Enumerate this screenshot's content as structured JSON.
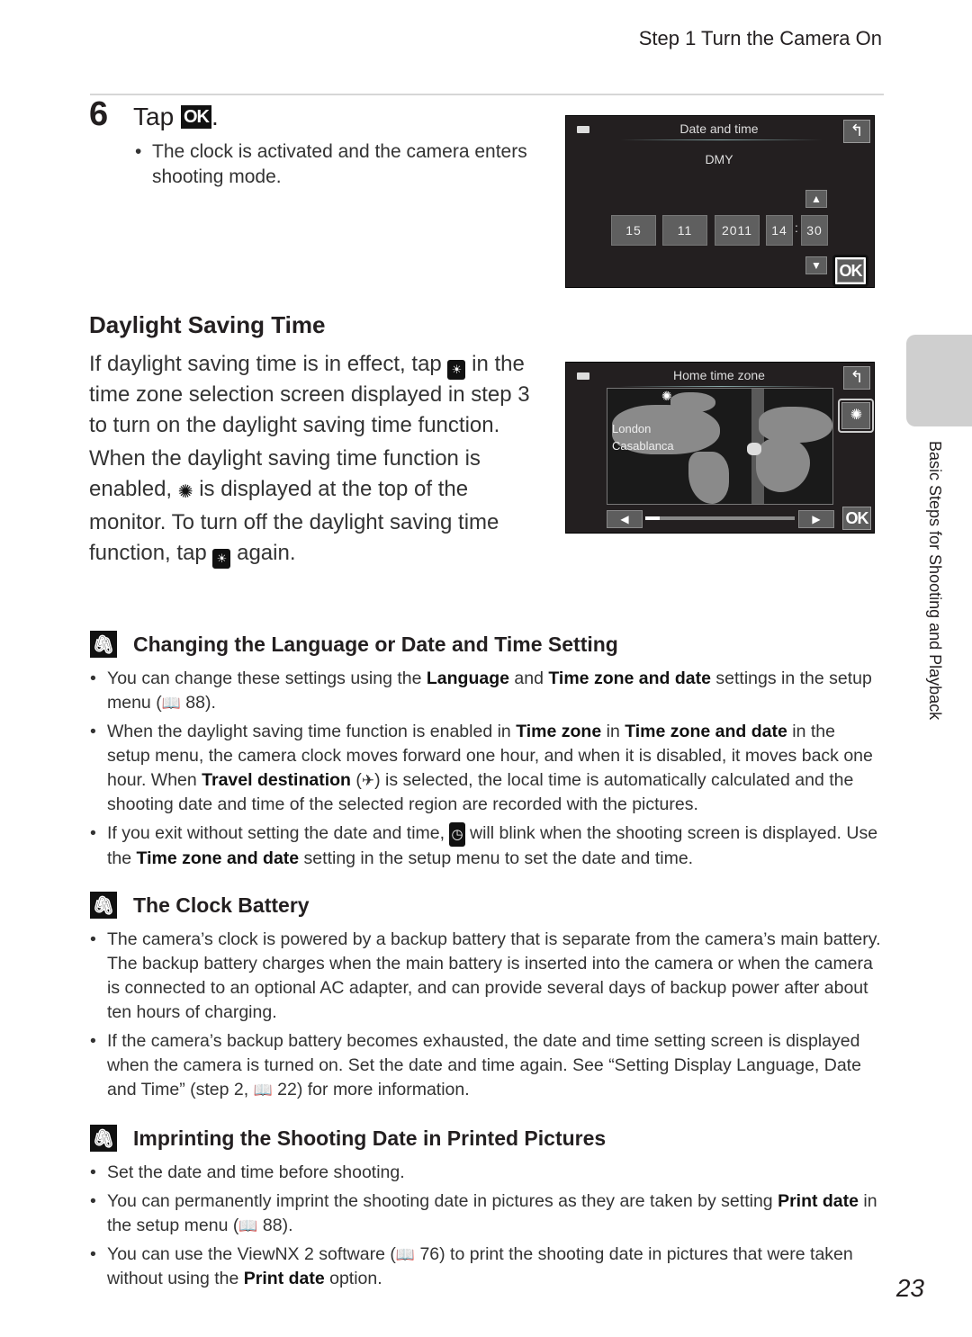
{
  "header": {
    "title": "Step 1 Turn the Camera On"
  },
  "step6": {
    "number": "6",
    "title_prefix": "Tap ",
    "title_icon": "OK",
    "title_suffix": ".",
    "bullets": [
      "The clock is activated and the camera enters shooting mode."
    ]
  },
  "screen_date_time": {
    "title": "Date and time",
    "format": "DMY",
    "fields": [
      "15",
      "11",
      "2011",
      "14",
      "30"
    ],
    "separator": ":",
    "back_icon": "back-arrow",
    "up_icon": "▲",
    "down_icon": "▼",
    "ok_label": "OK"
  },
  "dst": {
    "heading": "Daylight Saving Time",
    "para1_a": "If daylight saving time is in effect, tap ",
    "para1_b": " in the time zone selection screen displayed in step 3 to turn on the daylight saving time function.",
    "para2_a": "When the daylight saving time function is enabled, ",
    "para2_b": " is displayed at the top of the monitor. To turn off the daylight saving time function, tap ",
    "para2_c": " again."
  },
  "screen_home_zone": {
    "title": "Home time zone",
    "cities": [
      "London",
      "Casablanca"
    ],
    "back_icon": "back-arrow",
    "left_icon": "◀",
    "right_icon": "▶",
    "ok_label": "OK",
    "slider_position": 0.05
  },
  "notes": [
    {
      "title": "Changing the Language or Date and Time Setting",
      "items": [
        [
          {
            "t": "You can change these settings using the "
          },
          {
            "b": "Language"
          },
          {
            "t": " and "
          },
          {
            "b": "Time zone and date"
          },
          {
            "t": " settings in the setup menu ("
          },
          {
            "i": "book"
          },
          {
            "t": " 88)."
          }
        ],
        [
          {
            "t": "When the daylight saving time function is enabled in "
          },
          {
            "b": "Time zone"
          },
          {
            "t": " in "
          },
          {
            "b": "Time zone and date"
          },
          {
            "t": " in the setup menu, the camera clock moves forward one hour, and when it is disabled, it moves back one hour. When "
          },
          {
            "b": "Travel destination"
          },
          {
            "t": " ("
          },
          {
            "i": "plane"
          },
          {
            "t": ") is selected, the local time is automatically calculated and the shooting date and time of the selected region are recorded with the pictures."
          }
        ],
        [
          {
            "t": "If you exit without setting the date and time, "
          },
          {
            "i": "clock"
          },
          {
            "t": " will blink when the shooting screen is displayed. Use the "
          },
          {
            "b": "Time zone and date"
          },
          {
            "t": " setting in the setup menu to set the date and time."
          }
        ]
      ]
    },
    {
      "title": "The Clock Battery",
      "items": [
        [
          {
            "t": "The camera’s clock is powered by a backup battery that is separate from the camera’s main battery. The backup battery charges when the main battery is inserted into the camera or when the camera is connected to an optional AC adapter, and can provide several days of backup power after about ten hours of charging."
          }
        ],
        [
          {
            "t": "If the camera’s backup battery becomes exhausted, the date and time setting screen is displayed when the camera is turned on. Set the date and time again. See “Setting Display Language, Date and Time” (step 2, "
          },
          {
            "i": "book"
          },
          {
            "t": " 22) for more information."
          }
        ]
      ]
    },
    {
      "title": "Imprinting the Shooting Date in Printed Pictures",
      "items": [
        [
          {
            "t": "Set the date and time before shooting."
          }
        ],
        [
          {
            "t": "You can permanently imprint the shooting date in pictures as they are taken by setting "
          },
          {
            "b": "Print date"
          },
          {
            "t": " in the setup menu ("
          },
          {
            "i": "book"
          },
          {
            "t": " 88)."
          }
        ],
        [
          {
            "t": "You can use the ViewNX 2 software ("
          },
          {
            "i": "book"
          },
          {
            "t": " 76) to print the shooting date in pictures that were taken without using the "
          },
          {
            "b": "Print date"
          },
          {
            "t": " option."
          }
        ]
      ]
    }
  ],
  "side_tab": {
    "label": "Basic Steps for Shooting and Playback"
  },
  "page_number": "23"
}
